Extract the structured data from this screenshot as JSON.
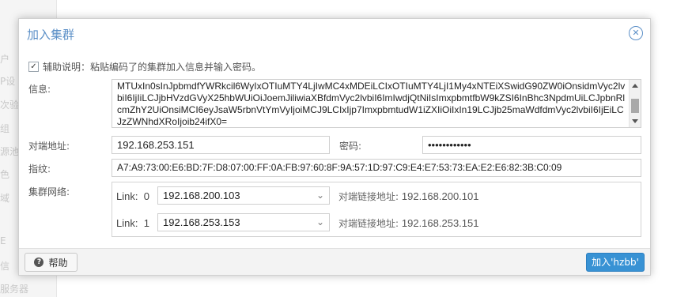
{
  "background": {
    "items": [
      "户",
      "P设",
      "次验",
      "组",
      "源池",
      "色",
      "域",
      "E",
      "信",
      "服务器"
    ]
  },
  "dialog": {
    "title": "加入集群",
    "assist": {
      "checked": true,
      "label": "辅助说明：粘贴编码了的集群加入信息并输入密码。"
    },
    "info": {
      "label": "信息:",
      "value": "MTUxIn0sInJpbmdfYWRkcil6WyIxOTIuMTY4LjIwMC4xMDEiLCIxOTIuMTY4LjI1My4xNTEiXSwidG90ZW0iOnsidmVyc2lvbiI6IjIiLCJjbHVzdGVyX25hbWUiOiJoemJiliwiaXBfdmVyc2lvbiI6ImIwdjQtNiIsImxpbmtfbW9kZSI6InBhc3NpdmUiLCJpbnRlcmZhY2UiOnsiMCI6eyJsaW5rbnVtYmVyIjoiMCJ9LCIxIjp7ImxpbmtudW1iZXIiOiIxIn19LCJjb25maWdfdmVyc2lvbiI6IjEiLCJzZWNhdXRoIjoib24ifX0="
    },
    "peer_address": {
      "label": "对端地址:",
      "value": "192.168.253.151"
    },
    "password": {
      "label": "密码:",
      "value": "••••••••••••"
    },
    "fingerprint": {
      "label": "指纹:",
      "value": "A7:A9:73:00:E6:BD:7F:D8:07:00:FF:0A:FB:97:60:8F:9A:57:1D:97:C9:E4:E7:53:73:EA:E2:E6:82:3B:C0:09"
    },
    "cluster_network": {
      "label": "集群网络:",
      "links": [
        {
          "label": "Link:",
          "num": "0",
          "value": "192.168.200.103",
          "peer_label": "对端链接地址:",
          "peer_value": "192.168.200.101"
        },
        {
          "label": "Link:",
          "num": "1",
          "value": "192.168.253.153",
          "peer_label": "对端链接地址:",
          "peer_value": "192.168.253.151"
        }
      ]
    },
    "footer": {
      "help_label": "帮助",
      "join_label": "加入'hzbb'"
    }
  },
  "colors": {
    "title": "#5b8fc7",
    "primary_button": "#3892d4"
  }
}
